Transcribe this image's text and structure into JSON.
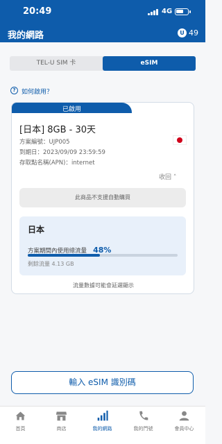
{
  "status_bar": {
    "time": "20:49",
    "network": "4G",
    "battery_level": 0.65
  },
  "header": {
    "title": "我的網路",
    "points_icon": "U",
    "points": "49"
  },
  "tabs": [
    {
      "label": "TEL-U SIM 卡",
      "active": false
    },
    {
      "label": "eSIM",
      "active": true
    }
  ],
  "help": {
    "icon": "question-circle-icon",
    "icon_glyph": "?",
    "label": "如何啟用？"
  },
  "plan": {
    "status_label": "已啟用",
    "name": "[日本] 8GB - 30天",
    "flag": "japan-flag-icon",
    "details": [
      {
        "label": "方案編號：",
        "value": "UJP005"
      },
      {
        "label": "到期日：",
        "value": "2023/09/09  23:59:59"
      },
      {
        "label": "存取點名稱(APN)：",
        "value": "internet"
      }
    ],
    "collapse_label": "收回 ˄",
    "auto_purchase_notice": "此商品不支援自動購買",
    "usage": {
      "country": "日本",
      "label": "方案期間內使用總流量",
      "percent_text": "48%",
      "percent_value": 48,
      "remaining": "剩餘流量 4.13 GB"
    },
    "display_note": "流量數據可能會延遲顯示"
  },
  "actions": {
    "enter_esim_label": "輸入 eSIM 識別碼"
  },
  "nav": [
    {
      "label": "首頁",
      "icon": "home-icon",
      "active": false
    },
    {
      "label": "商店",
      "icon": "store-icon",
      "active": false
    },
    {
      "label": "我的網路",
      "icon": "signal-bars-icon",
      "active": true
    },
    {
      "label": "我的門號",
      "icon": "phone-icon",
      "active": false
    },
    {
      "label": "會員中心",
      "icon": "user-icon",
      "active": false
    }
  ],
  "colors": {
    "brand": "#0e5cab",
    "background": "#f6f7f9",
    "flag_red": "#d0021b"
  }
}
